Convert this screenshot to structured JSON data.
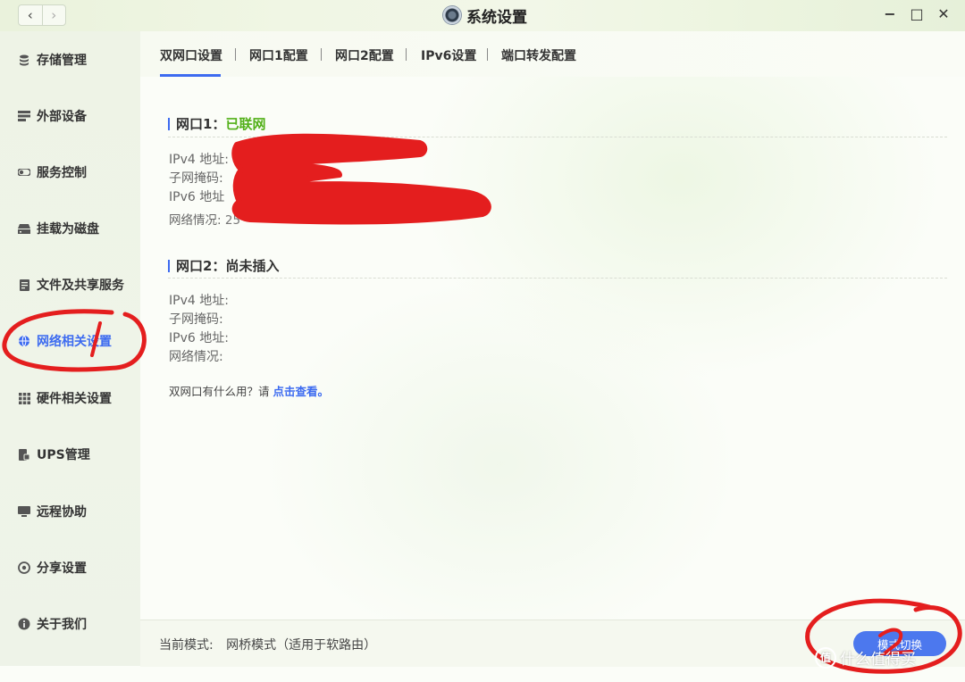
{
  "window": {
    "title": "系统设置"
  },
  "titlebar": {
    "back_icon": "‹",
    "forward_icon": "›",
    "minimize_icon": "−",
    "maximize_icon": "□",
    "close_icon": "✕"
  },
  "sidebar": {
    "items": [
      {
        "label": "存储管理",
        "icon": "database-icon"
      },
      {
        "label": "外部设备",
        "icon": "device-icon"
      },
      {
        "label": "服务控制",
        "icon": "toggle-icon"
      },
      {
        "label": "挂载为磁盘",
        "icon": "disk-icon"
      },
      {
        "label": "文件及共享服务",
        "icon": "file-share-icon"
      },
      {
        "label": "网络相关设置",
        "icon": "globe-icon",
        "active": true
      },
      {
        "label": "硬件相关设置",
        "icon": "grid-icon"
      },
      {
        "label": "UPS管理",
        "icon": "ups-icon"
      },
      {
        "label": "远程协助",
        "icon": "monitor-icon"
      },
      {
        "label": "分享设置",
        "icon": "share-icon"
      },
      {
        "label": "关于我们",
        "icon": "info-icon"
      }
    ]
  },
  "tabs": [
    {
      "label": "双网口设置",
      "active": true
    },
    {
      "label": "网口1配置"
    },
    {
      "label": "网口2配置"
    },
    {
      "label": "IPv6设置"
    },
    {
      "label": "端口转发配置"
    }
  ],
  "port1": {
    "title": "网口1：",
    "status": "已联网",
    "rows": [
      {
        "label": "IPv4 地址:"
      },
      {
        "label": "子网掩码:"
      },
      {
        "label": "IPv6 地址"
      },
      {
        "label": "网络情况:",
        "value": "25"
      }
    ]
  },
  "port2": {
    "title": "网口2：",
    "status": "尚未插入",
    "rows": [
      {
        "label": "IPv4 地址:"
      },
      {
        "label": "子网掩码:"
      },
      {
        "label": "IPv6 地址:"
      },
      {
        "label": "网络情况:"
      }
    ]
  },
  "help": {
    "text": "双网口有什么用？请 ",
    "link": "点击查看。"
  },
  "footer": {
    "mode_label": "当前模式:",
    "mode_value": "网桥模式（适用于软路由）",
    "switch_button": "模式切换"
  },
  "watermark": {
    "logo": "值",
    "text": "什么值得买"
  },
  "colors": {
    "accent": "#3d6bf0",
    "status_ok": "#52b018",
    "annotation_red": "#e41e1e"
  }
}
